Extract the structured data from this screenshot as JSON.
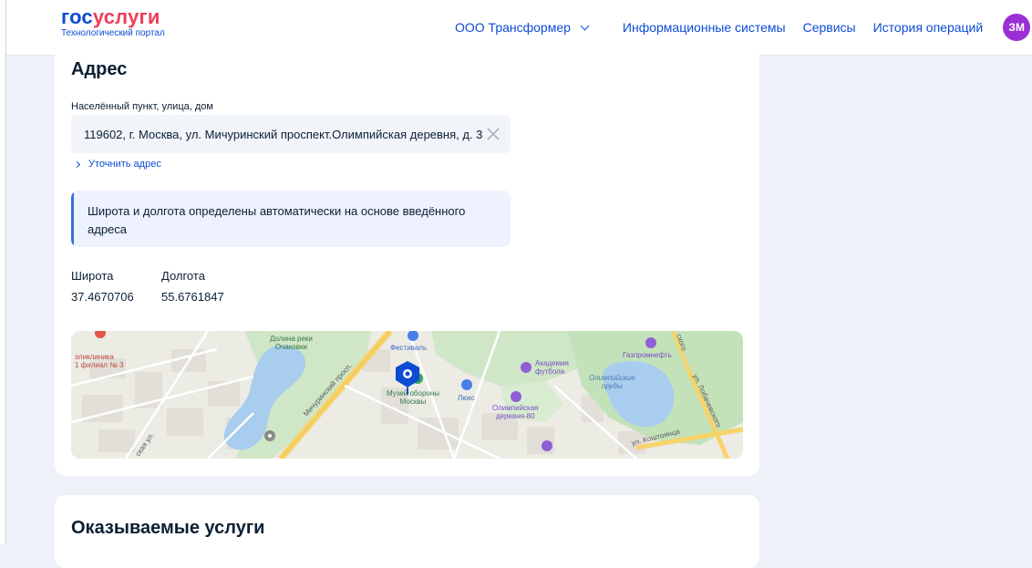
{
  "header": {
    "logo_part1": "гос",
    "logo_part2": "услуги",
    "logo_subtitle": "Технологический портал",
    "org_name": "ООО Трансформер",
    "nav": [
      "Информационные системы",
      "Сервисы",
      "История операций"
    ],
    "avatar_initials": "ЗМ"
  },
  "address_section": {
    "title": "Адрес",
    "field_label": "Населённый пункт, улица, дом",
    "address_value": "119602, г. Москва, ул. Мичуринский проспект.Олимпийская деревня, д. 3",
    "clarify_link": "Уточнить адрес",
    "notice_text": "Широта и долгота определены автоматически на основе введённого адреса",
    "latitude_label": "Широта",
    "latitude_value": "37.4670706",
    "longitude_label": "Долгота",
    "longitude_value": "55.6761847"
  },
  "map": {
    "labels": {
      "clinic": "эликлиника\n1 филиал № 3",
      "valley": "Долина реки\nОчаковки",
      "festival": "Фестиваль",
      "academy": "Академия\nфутбола",
      "gazprom": "Газпромнефть",
      "ponds": "Олимпийские\nпруды",
      "museum": "Музей обороны\nМосквы",
      "lux": "Люкс",
      "village": "Олимпийская\nдеревня-80",
      "michurinsky": "Мичуринский просп.",
      "lobachevsky": "ул. Лобачевского",
      "koshtoyanca": "ул. Коштоянца",
      "street_partial": "ская ул.",
      "top_partial": "ского"
    }
  },
  "services_section": {
    "title": "Оказываемые услуги"
  },
  "colors": {
    "brand_blue": "#0d4cd3",
    "brand_red": "#ee3f58",
    "avatar": "#9b2fd6",
    "notice_bar": "#3a6fd9"
  }
}
